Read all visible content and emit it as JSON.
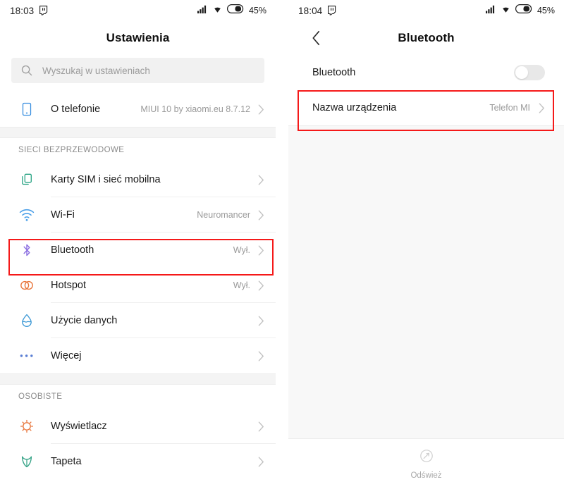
{
  "left": {
    "status_bar": {
      "time": "18:03",
      "app_icon": "twitch-icon",
      "signal_icon": "cellular-signal-icon",
      "wifi_icon": "wifi-icon",
      "battery_icon": "battery-icon",
      "battery_text": "45%"
    },
    "title": "Ustawienia",
    "search": {
      "icon": "search-icon",
      "placeholder": "Wyszukaj w ustawieniach",
      "value": ""
    },
    "top_rows": [
      {
        "icon": "phone-icon",
        "icon_color": "#3a8fe0",
        "label": "O telefonie",
        "value": "MIUI 10 by xiaomi.eu 8.7.12"
      }
    ],
    "sections": [
      {
        "header": "SIECI BEZPRZEWODOWE",
        "rows": [
          {
            "icon": "sim-cards-icon",
            "icon_color": "#27a383",
            "label": "Karty SIM i sieć mobilna",
            "value": ""
          },
          {
            "icon": "wifi-icon",
            "icon_color": "#4a9fe8",
            "label": "Wi-Fi",
            "value": "Neuromancer"
          },
          {
            "icon": "bluetooth-icon",
            "icon_color": "#8a6de0",
            "label": "Bluetooth",
            "value": "Wył."
          },
          {
            "icon": "hotspot-icon",
            "icon_color": "#e8763c",
            "label": "Hotspot",
            "value": "Wył."
          },
          {
            "icon": "data-usage-icon",
            "icon_color": "#3f9ad6",
            "label": "Użycie danych",
            "value": ""
          },
          {
            "icon": "more-dots-icon",
            "icon_color": "#5b7fd4",
            "label": "Więcej",
            "value": ""
          }
        ]
      },
      {
        "header": "OSOBISTE",
        "rows": [
          {
            "icon": "display-sun-icon",
            "icon_color": "#e8763c",
            "label": "Wyświetlacz",
            "value": ""
          },
          {
            "icon": "wallpaper-tulip-icon",
            "icon_color": "#36a387",
            "label": "Tapeta",
            "value": ""
          }
        ]
      }
    ],
    "highlight_color": "#f51919"
  },
  "right": {
    "status_bar": {
      "time": "18:04",
      "app_icon": "twitch-icon",
      "signal_icon": "cellular-signal-icon",
      "wifi_icon": "wifi-icon",
      "battery_icon": "battery-icon",
      "battery_text": "45%"
    },
    "back_icon": "chevron-left-icon",
    "title": "Bluetooth",
    "rows": [
      {
        "label": "Bluetooth",
        "control": "toggle",
        "toggle_on": false
      },
      {
        "label": "Nazwa urządzenia",
        "control": "value",
        "value": "Telefon MI"
      }
    ],
    "bottom_bar": {
      "icon": "refresh-icon",
      "label": "Odśwież"
    },
    "highlight_color": "#f51919"
  }
}
